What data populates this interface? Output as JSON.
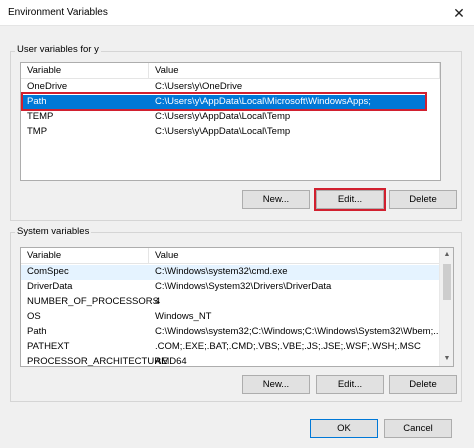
{
  "window": {
    "title": "Environment Variables",
    "close_glyph": "✕"
  },
  "user_vars": {
    "group_label": "User variables for y",
    "col_variable": "Variable",
    "col_value": "Value",
    "rows": [
      {
        "name": "OneDrive",
        "value": "C:\\Users\\y\\OneDrive"
      },
      {
        "name": "Path",
        "value": "C:\\Users\\y\\AppData\\Local\\Microsoft\\WindowsApps;"
      },
      {
        "name": "TEMP",
        "value": "C:\\Users\\y\\AppData\\Local\\Temp"
      },
      {
        "name": "TMP",
        "value": "C:\\Users\\y\\AppData\\Local\\Temp"
      }
    ],
    "new_label": "New...",
    "edit_label": "Edit...",
    "delete_label": "Delete"
  },
  "system_vars": {
    "group_label": "System variables",
    "col_variable": "Variable",
    "col_value": "Value",
    "rows": [
      {
        "name": "ComSpec",
        "value": "C:\\Windows\\system32\\cmd.exe"
      },
      {
        "name": "DriverData",
        "value": "C:\\Windows\\System32\\Drivers\\DriverData"
      },
      {
        "name": "NUMBER_OF_PROCESSORS",
        "value": "4"
      },
      {
        "name": "OS",
        "value": "Windows_NT"
      },
      {
        "name": "Path",
        "value": "C:\\Windows\\system32;C:\\Windows;C:\\Windows\\System32\\Wbem;..."
      },
      {
        "name": "PATHEXT",
        "value": ".COM;.EXE;.BAT;.CMD;.VBS;.VBE;.JS;.JSE;.WSF;.WSH;.MSC"
      },
      {
        "name": "PROCESSOR_ARCHITECTURE",
        "value": "AMD64"
      }
    ],
    "new_label": "New...",
    "edit_label": "Edit...",
    "delete_label": "Delete"
  },
  "footer": {
    "ok_label": "OK",
    "cancel_label": "Cancel"
  },
  "colors": {
    "selection": "#0078d7",
    "highlight": "#d1202f",
    "hover": "#e5f3ff"
  }
}
